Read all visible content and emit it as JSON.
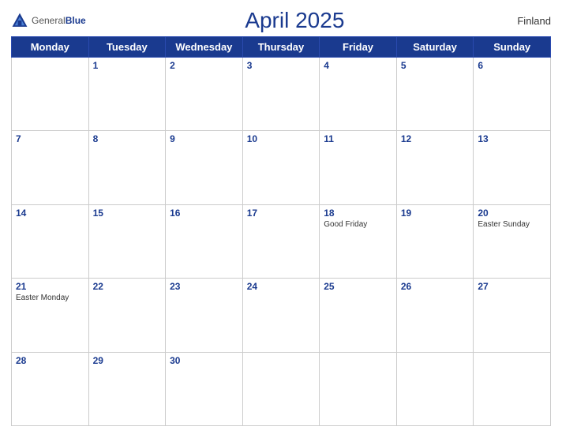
{
  "header": {
    "logo_general": "General",
    "logo_blue": "Blue",
    "title": "April 2025",
    "country": "Finland"
  },
  "weekdays": [
    "Monday",
    "Tuesday",
    "Wednesday",
    "Thursday",
    "Friday",
    "Saturday",
    "Sunday"
  ],
  "weeks": [
    [
      {
        "day": "",
        "holiday": ""
      },
      {
        "day": "1",
        "holiday": ""
      },
      {
        "day": "2",
        "holiday": ""
      },
      {
        "day": "3",
        "holiday": ""
      },
      {
        "day": "4",
        "holiday": ""
      },
      {
        "day": "5",
        "holiday": ""
      },
      {
        "day": "6",
        "holiday": ""
      }
    ],
    [
      {
        "day": "7",
        "holiday": ""
      },
      {
        "day": "8",
        "holiday": ""
      },
      {
        "day": "9",
        "holiday": ""
      },
      {
        "day": "10",
        "holiday": ""
      },
      {
        "day": "11",
        "holiday": ""
      },
      {
        "day": "12",
        "holiday": ""
      },
      {
        "day": "13",
        "holiday": ""
      }
    ],
    [
      {
        "day": "14",
        "holiday": ""
      },
      {
        "day": "15",
        "holiday": ""
      },
      {
        "day": "16",
        "holiday": ""
      },
      {
        "day": "17",
        "holiday": ""
      },
      {
        "day": "18",
        "holiday": "Good Friday"
      },
      {
        "day": "19",
        "holiday": ""
      },
      {
        "day": "20",
        "holiday": "Easter Sunday"
      }
    ],
    [
      {
        "day": "21",
        "holiday": "Easter Monday"
      },
      {
        "day": "22",
        "holiday": ""
      },
      {
        "day": "23",
        "holiday": ""
      },
      {
        "day": "24",
        "holiday": ""
      },
      {
        "day": "25",
        "holiday": ""
      },
      {
        "day": "26",
        "holiday": ""
      },
      {
        "day": "27",
        "holiday": ""
      }
    ],
    [
      {
        "day": "28",
        "holiday": ""
      },
      {
        "day": "29",
        "holiday": ""
      },
      {
        "day": "30",
        "holiday": ""
      },
      {
        "day": "",
        "holiday": ""
      },
      {
        "day": "",
        "holiday": ""
      },
      {
        "day": "",
        "holiday": ""
      },
      {
        "day": "",
        "holiday": ""
      }
    ]
  ]
}
